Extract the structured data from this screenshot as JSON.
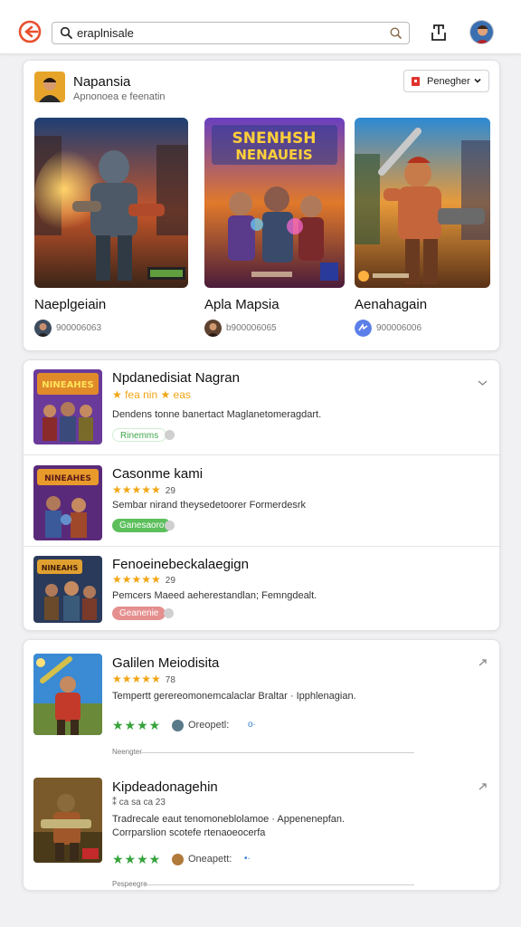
{
  "search": {
    "query": "eraplnisale"
  },
  "featured": {
    "title": "Napansia",
    "subtitle": "Apnonoea e feenatin",
    "dropdown_label": "Penegher",
    "items": [
      {
        "name": "Naeplgeiain",
        "meta": "900006063"
      },
      {
        "name": "Apla Mapsia",
        "meta": "b900006065"
      },
      {
        "name": "Aenahagain",
        "meta": "900006006"
      }
    ]
  },
  "list1": [
    {
      "title": "Npdanedisiat Nagran",
      "rating_text": "★ fea nin ★ eas",
      "desc": "Dendens tonne banertact Maglanetomeragdart.",
      "pill": "Rinemms",
      "pill_color": "#ffffff",
      "pill_text_color": "#3fa64a"
    },
    {
      "title": "Casonme kami",
      "rating_value": "29",
      "desc": "Sembar nirand theysedetoorer Formerdesrk",
      "pill": "Ganesaoro",
      "pill_color": "#5cbf5c",
      "pill_text_color": "#ffffff"
    },
    {
      "title": "Fenoeinebeckalaegign",
      "rating_value": "29",
      "desc": "Pemcers Maeed aeherestandlan; Femngdealt.",
      "pill": "Geanenie",
      "pill_color": "#e58f8f",
      "pill_text_color": "#ffffff"
    }
  ],
  "list2": [
    {
      "title": "Galilen Meiodisita",
      "rating_value": "78",
      "desc": "Tempertt gerereomonemcalaclar Braltar · Ipphlenagian.",
      "owner": "Oreopetl:",
      "sep_label": "Neengter"
    },
    {
      "title": "Kipdeadonagehin",
      "rating_text": "⁑ ca sa ca 23",
      "desc": "Tradrecale eaut tenomoneblolamoe · Appenenepfan.",
      "desc2": "Corrparslion scotefe rtenaoeocerfa",
      "owner": "Oneapett:",
      "sep_label": "Pespeegre"
    }
  ],
  "colors": {
    "accent": "#e8502e",
    "star": "#f2a514",
    "green_star": "#35a33a"
  }
}
